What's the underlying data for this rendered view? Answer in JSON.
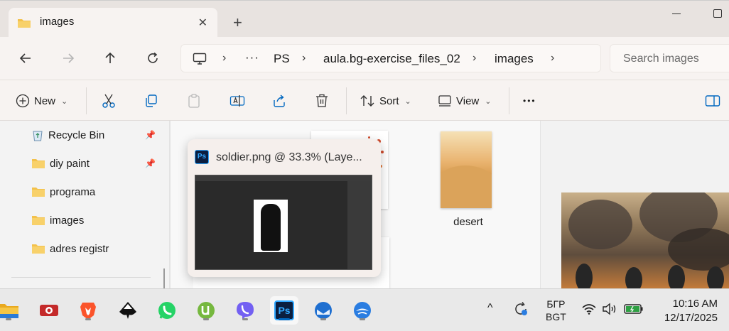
{
  "tab": {
    "title": "images",
    "close_glyph": "✕",
    "new_tab_glyph": "+"
  },
  "address": {
    "more_glyph": "···",
    "crumbs": [
      "PS",
      "aula.bg-exercise_files_02",
      "images"
    ],
    "sep": "›"
  },
  "search": {
    "placeholder": "Search images"
  },
  "toolbar": {
    "new_label": "New",
    "sort_label": "Sort",
    "view_label": "View",
    "more_glyph": "•••"
  },
  "sidebar": {
    "items": [
      {
        "label": "Recycle Bin",
        "pinned": true
      },
      {
        "label": "diy paint",
        "pinned": true
      },
      {
        "label": "programa",
        "pinned": false
      },
      {
        "label": "images",
        "pinned": false
      },
      {
        "label": "adres registr",
        "pinned": false
      }
    ]
  },
  "files": {
    "desert_label": "desert"
  },
  "popup": {
    "title": "soldier.png @ 33.3% (Laye...",
    "app_icon_text": "Ps"
  },
  "taskbar": {
    "photoshop_icon_text": "Ps",
    "language_line1": "БГР",
    "language_line2": "BGT",
    "time": "10:16 AM",
    "date": "12/17/2025",
    "tray_up_glyph": "^"
  },
  "colors": {
    "accent": "#0067c0",
    "folder": "#f3c14b",
    "photoshop": "#31a8ff"
  }
}
